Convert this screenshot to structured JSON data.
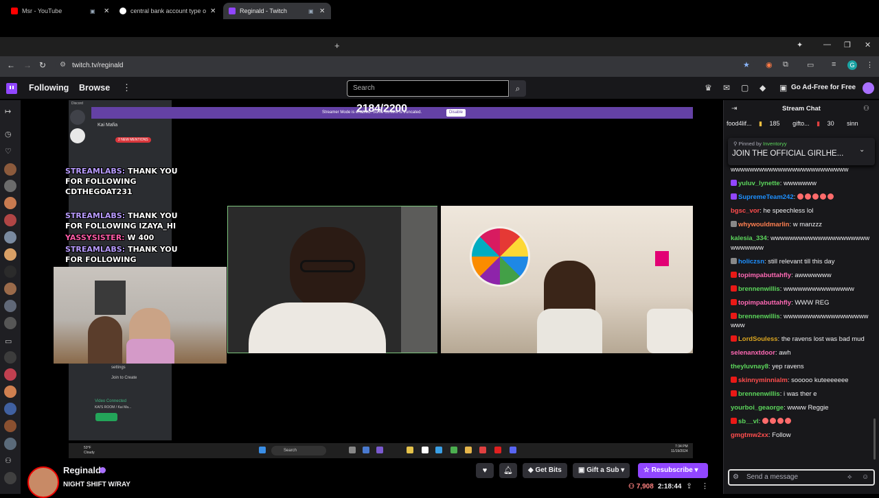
{
  "browser": {
    "tabs": [
      {
        "label": "Msr - YouTube",
        "favicon_color": "#ff0000",
        "active": false
      },
      {
        "label": "central bank account type of us",
        "favicon_color": "#ffffff",
        "active": false
      },
      {
        "label": "Reginald - Twitch",
        "favicon_color": "#9146ff",
        "active": true
      }
    ],
    "url": "twitch.tv/reginald",
    "profile_initial": "G"
  },
  "twitch_nav": {
    "following": "Following",
    "browse": "Browse",
    "search_placeholder": "Search",
    "ad_free": "Go Ad-Free for Free"
  },
  "stream_overlay": {
    "counter": "2184/2200",
    "discord_label": "Discord",
    "discord_server": "Kai Mafia",
    "discord_mentions": "2 NEW MENTIONS",
    "streamer_mode_text": "Streamer Mode is enabled. Some content is truncated.",
    "disable_label": "Disable",
    "alerts": [
      {
        "label": "STREAMLABS:",
        "text": " THANK YOU FOR FOLLOWING CDTHEGOAT231"
      },
      {
        "label": "STREAMLABS:",
        "text": " THANK YOU FOR FOLLOWING IZAYA_HI"
      },
      {
        "label": "YASSYSISTER:",
        "text": " W 400"
      },
      {
        "label": "STREAMLABS:",
        "text": " THANK YOU FOR FOLLOWING"
      }
    ],
    "discord_join": "Join to Create",
    "discord_settings": "settings",
    "discord_video": "Video Connected",
    "discord_room": "KAI'S ROOM / Kai Ma...",
    "taskbar_search": "Search",
    "taskbar_time": "7:34 PM",
    "taskbar_date": "11/19/2024",
    "weather_temp": "53°F",
    "weather_desc": "Cloudy"
  },
  "channel": {
    "name": "Reginald",
    "title": "NIGHT SHIFT W/RAY",
    "get_bits": "Get Bits",
    "gift_sub": "Gift a Sub",
    "resubscribe": "Resubscribe",
    "viewers": "7,908",
    "uptime": "2:18:44"
  },
  "chat": {
    "header": "Stream Chat",
    "gift_leaders": [
      {
        "name": "food4lif...",
        "count": "185"
      },
      {
        "name": "gifto...",
        "count": "30"
      },
      {
        "name": "sinn",
        "count": ""
      }
    ],
    "pinned_by": "Pinned by",
    "pinned_by_user": "Inventoryy",
    "pinned_message": "JOIN THE OFFICIAL GIRLHE...",
    "messages": [
      {
        "user": "",
        "color": "#efeff1",
        "text": "wwwwwwwwwwwwwwwwwwwwwwwww"
      },
      {
        "user": "yuluv_lynette",
        "color": "#5cd65c",
        "text": ": wwwwwww",
        "badge": "#9146ff"
      },
      {
        "user": "SupremeTeam242",
        "color": "#1e90ff",
        "text": ": ",
        "emotes": 5,
        "badge": "#9146ff"
      },
      {
        "user": "bgsc_vor",
        "color": "#ff4d4d",
        "text": ": he speechless lol"
      },
      {
        "user": "whywouldmarlin",
        "color": "#ff7f50",
        "text": ": w manzzz",
        "badge": "#888888"
      },
      {
        "user": "kalesia_334",
        "color": "#5cd65c",
        "text": ": wwwwwwwwwwwwwwwwwwwwwwwwwwww"
      },
      {
        "user": "holiczsn",
        "color": "#1e90ff",
        "text": ": still relevant till this day",
        "badge": "#888888"
      },
      {
        "user": "topimpabuttahfly",
        "color": "#ff69b4",
        "text": ": awwwwwww",
        "badge": "#e91916"
      },
      {
        "user": "brennenwillis",
        "color": "#5cd65c",
        "text": ": wwwwwwwwwwwwwww",
        "badge": "#e91916"
      },
      {
        "user": "topimpabuttahfly",
        "color": "#ff69b4",
        "text": ": WWW REG",
        "badge": "#e91916"
      },
      {
        "user": "brennenwillis",
        "color": "#5cd65c",
        "text": ": wwwwwwwwwwwwwwwwwwwww",
        "badge": "#e91916"
      },
      {
        "user": "LordSouless",
        "color": "#daa520",
        "text": ": the ravens lost was bad mud",
        "badge": "#e91916"
      },
      {
        "user": "selenanxtdoor",
        "color": "#ff69b4",
        "text": ": awh"
      },
      {
        "user": "theyluvnay8",
        "color": "#5cd65c",
        "text": ": yep ravens"
      },
      {
        "user": "skinnyminnialm",
        "color": "#ff4d4d",
        "text": ": sooooo kuteeeeeee",
        "badge": "#e91916"
      },
      {
        "user": "brennenwillis",
        "color": "#5cd65c",
        "text": ": i was ther e",
        "badge": "#e91916"
      },
      {
        "user": "yourboi_geaorge",
        "color": "#5cd65c",
        "text": ": wwww Reggie"
      },
      {
        "user": "sb__vl",
        "color": "#5cd65c",
        "text": ": ",
        "emotes": 4,
        "badge": "#e91916"
      },
      {
        "user": "gmgtmw2xx",
        "color": "#ff4d4d",
        "text": ": Follow"
      }
    ],
    "input_placeholder": "Send a message"
  }
}
